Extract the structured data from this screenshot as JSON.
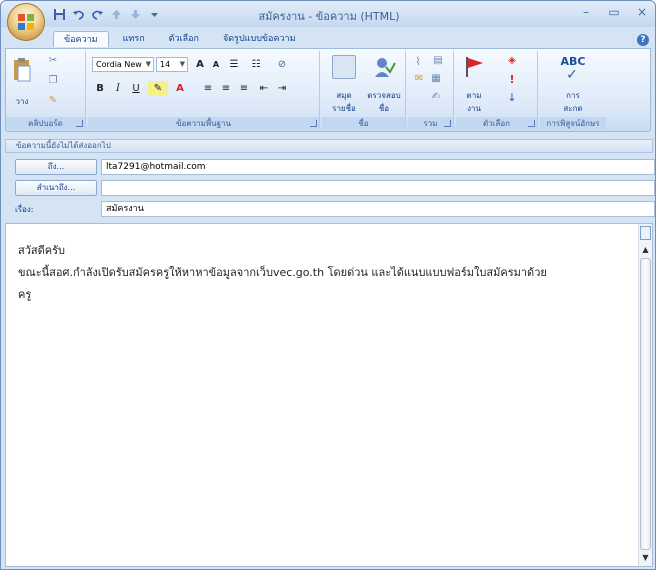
{
  "window": {
    "title": "สมัครงาน - ข้อความ (HTML)",
    "controls": [
      "–",
      "▭",
      "×"
    ]
  },
  "tabs": [
    {
      "label": "ข้อความ",
      "active": true
    },
    {
      "label": "แทรก",
      "active": false
    },
    {
      "label": "ตัวเลือก",
      "active": false
    },
    {
      "label": "จัดรูปแบบข้อความ",
      "active": false
    }
  ],
  "ribbon": {
    "groups": {
      "clipboard": {
        "label": "คลิปบอร์ด",
        "paste": "วาง"
      },
      "basic_text": {
        "label": "ข้อความพื้นฐาน",
        "font": "Cordia New",
        "size": "14"
      },
      "names": {
        "label": "ชื่อ",
        "address_book": "สมุด\nรายชื่อ",
        "check_names": "ตรวจสอบ\nชื่อ"
      },
      "include": {
        "label": "รวม"
      },
      "options": {
        "label": "ตัวเลือก",
        "follow_up": "ตาม\nงาน"
      },
      "proofing": {
        "label": "การพิสูจน์อักษร",
        "spelling": "การ\nสะกด",
        "abc": "ABC"
      }
    }
  },
  "message": {
    "infobar": "ข้อความนี้ยังไม่ได้ส่งออกไป",
    "to_label": "ถึง...",
    "to_value": "lta7291@hotmail.com",
    "cc_label": "สำเนาถึง...",
    "cc_value": "",
    "subject_label": "เรื่อง:",
    "subject_value": "สมัครงาน",
    "body": [
      "สวัสดีครับ",
      "ขณะนี้สอศ.กำลังเปิดรับสมัครครูให้หาหาข้อมูลจากเว็บvec.go.th โดยด่วน และได้แนบแบบฟอร์มใบสมัครมาด้วย",
      "ครู"
    ]
  },
  "colors": {
    "accent": "#15428b",
    "ribbon": "#dbe8f8"
  }
}
